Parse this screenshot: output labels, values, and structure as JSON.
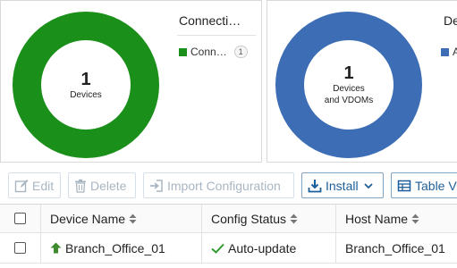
{
  "colors": {
    "connected": "#1a8f1a",
    "vdoms": "#3d6eb5",
    "install_blue": "#1f5f99",
    "success_check": "#2e9a2e",
    "device_arrow": "#3e8a2e"
  },
  "widget_devices": {
    "count": "1",
    "label": "Devices",
    "legend_title": "Connecti…",
    "legend_item": "Conn…",
    "legend_count": "1"
  },
  "widget_vdoms": {
    "count": "1",
    "label_line1": "Devices",
    "label_line2": "and VDOMs",
    "legend_title": "De",
    "legend_item": "A"
  },
  "toolbar": {
    "edit": "Edit",
    "delete": "Delete",
    "import": "Import Configuration",
    "install": "Install",
    "table_view": "Table V"
  },
  "table": {
    "columns": [
      "Device Name",
      "Config Status",
      "Host Name"
    ],
    "rows": [
      {
        "device_name": "Branch_Office_01",
        "config_status": "Auto-update",
        "host_name": "Branch_Office_01"
      }
    ]
  }
}
